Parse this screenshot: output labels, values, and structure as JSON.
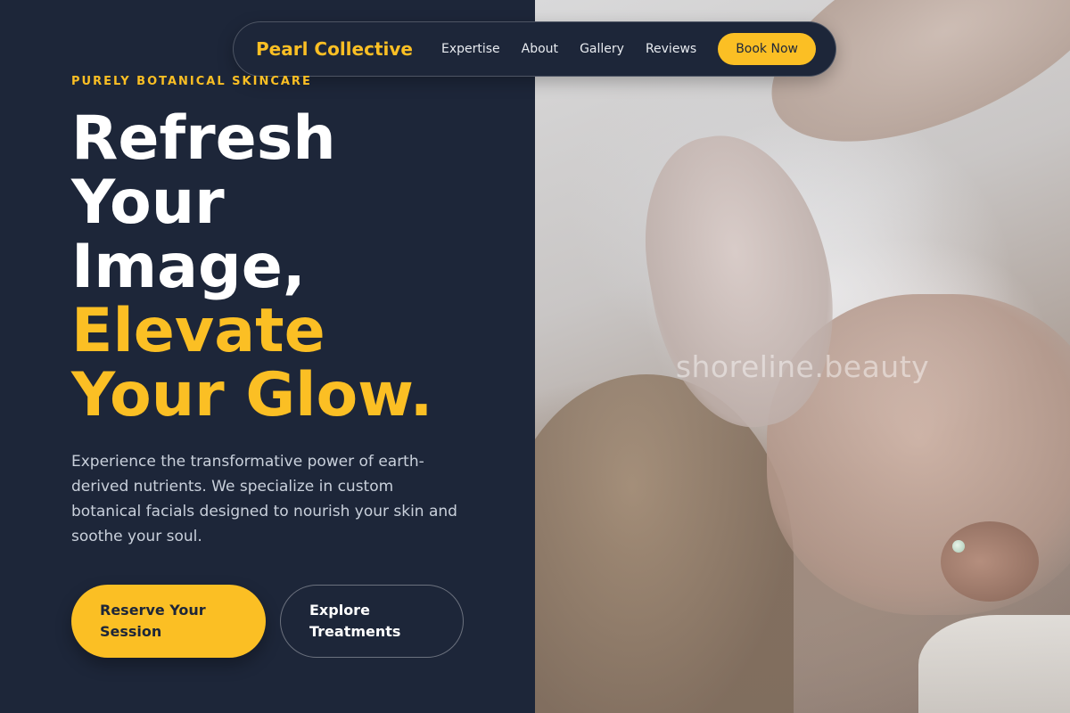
{
  "brand": {
    "name": "Pearl Collective"
  },
  "nav": {
    "links": [
      "Expertise",
      "About",
      "Gallery",
      "Reviews"
    ],
    "cta": "Book Now"
  },
  "hero": {
    "eyebrow": "PURELY BOTANICAL SKINCARE",
    "headline_lines": [
      "Refresh",
      "Your",
      "Image,"
    ],
    "accent_lines": [
      "Elevate",
      "Your Glow."
    ],
    "description": "Experience the transformative power of earth-derived nutrients. We specialize in custom botanical facials designed to nourish your skin and soothe your soul.",
    "primary_cta": "Reserve Your Session",
    "secondary_cta": "Explore Treatments"
  },
  "image": {
    "watermark": "shoreline.beauty"
  },
  "colors": {
    "background": "#1d2639",
    "accent": "#fbbf24",
    "text_light": "#ffffff",
    "text_muted": "#c9d0db"
  }
}
